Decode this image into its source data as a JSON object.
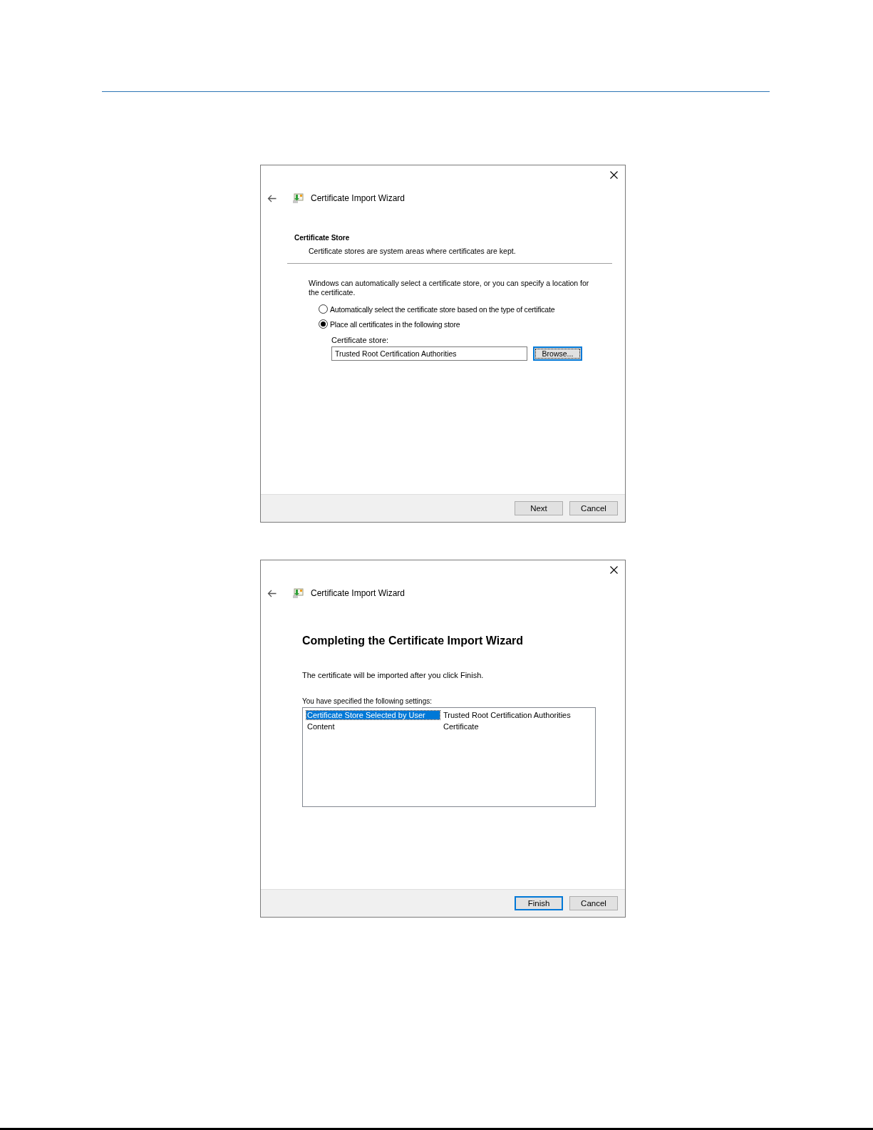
{
  "dialogs": [
    {
      "kind": "store",
      "title": "Certificate Import Wizard",
      "section_title": "Certificate Store",
      "section_subtitle": "Certificate stores are system areas where certificates are kept.",
      "description": "Windows can automatically select a certificate store, or you can specify a location for the certificate.",
      "options": [
        {
          "label": "Automatically select the certificate store based on the type of certificate",
          "selected": false
        },
        {
          "label": "Place all certificates in the following store",
          "selected": true
        }
      ],
      "store_label": "Certificate store:",
      "store_value": "Trusted Root Certification Authorities",
      "browse": {
        "label": "Browse...",
        "focused": true
      },
      "buttons": [
        {
          "label": "Next",
          "focused": false
        },
        {
          "label": "Cancel",
          "focused": false
        }
      ]
    },
    {
      "kind": "complete",
      "title": "Certificate Import Wizard",
      "heading": "Completing the Certificate Import Wizard",
      "text": "The certificate will be imported after you click Finish.",
      "settings_label": "You have specified the following settings:",
      "settings": [
        {
          "name": "Certificate Store Selected by User",
          "value": "Trusted Root Certification Authorities",
          "selected": true
        },
        {
          "name": "Content",
          "value": "Certificate",
          "selected": false
        }
      ],
      "buttons": [
        {
          "label": "Finish",
          "focused": true
        },
        {
          "label": "Cancel",
          "focused": false
        }
      ]
    }
  ]
}
